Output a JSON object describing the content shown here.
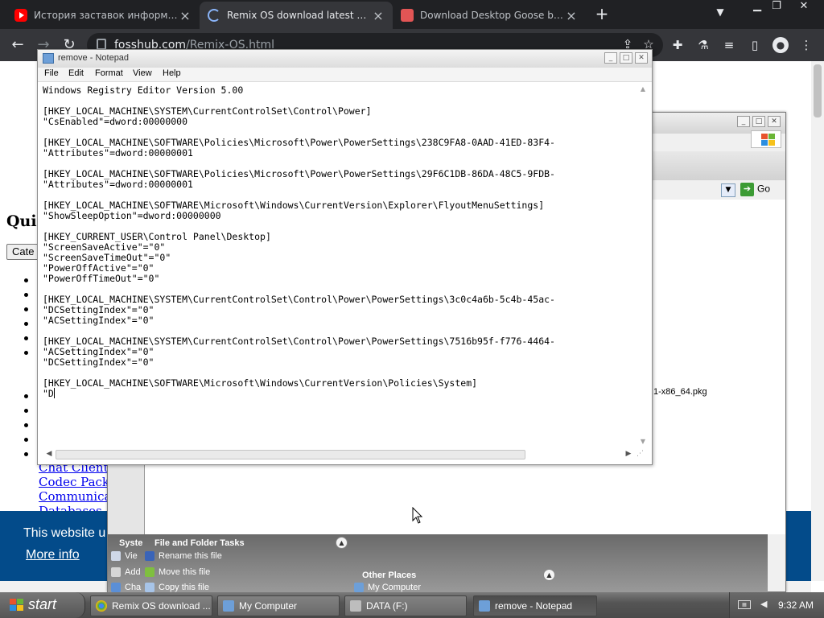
{
  "browser": {
    "tabs": [
      {
        "title": "История заставок информационн",
        "icon": "youtube-icon",
        "active": false
      },
      {
        "title": "Remix OS download latest version",
        "icon": "loading-spinner-icon",
        "active": true
      },
      {
        "title": "Download Desktop Goose by samp",
        "icon": "site-favicon-icon",
        "active": false
      }
    ],
    "url_host": "fosshub.com",
    "url_path": "/Remix-OS.html"
  },
  "webpage": {
    "heading": "Quic",
    "category_button": "Cate",
    "links": [
      "Chat Clients",
      "Codec Packs",
      "Communicat",
      "Databases"
    ],
    "cookie_text": "This website u",
    "cookie_more": "More info"
  },
  "explorer": {
    "go_label": "Go",
    "file_fragment": "1-x86_64.pkg",
    "tasks_header_left": "Syste",
    "tasks_header": "File and Folder Tasks",
    "tasks_left_items": [
      "Vie",
      "Add",
      "Cha"
    ],
    "tasks": [
      "Rename this file",
      "Move this file",
      "Copy this file"
    ],
    "other_places_header": "Other Places",
    "other_places": [
      "My Computer"
    ]
  },
  "notepad": {
    "title": "remove - Notepad",
    "menu": [
      "File",
      "Edit",
      "Format",
      "View",
      "Help"
    ],
    "lines": [
      "Windows Registry Editor Version 5.00",
      "",
      "[HKEY_LOCAL_MACHINE\\SYSTEM\\CurrentControlSet\\Control\\Power]",
      "\"CsEnabled\"=dword:00000000",
      "",
      "[HKEY_LOCAL_MACHINE\\SOFTWARE\\Policies\\Microsoft\\Power\\PowerSettings\\238C9FA8-0AAD-41ED-83F4-",
      "\"Attributes\"=dword:00000001",
      "",
      "[HKEY_LOCAL_MACHINE\\SOFTWARE\\Policies\\Microsoft\\Power\\PowerSettings\\29F6C1DB-86DA-48C5-9FDB-",
      "\"Attributes\"=dword:00000001",
      "",
      "[HKEY_LOCAL_MACHINE\\SOFTWARE\\Microsoft\\Windows\\CurrentVersion\\Explorer\\FlyoutMenuSettings]",
      "\"ShowSleepOption\"=dword:00000000",
      "",
      "[HKEY_CURRENT_USER\\Control Panel\\Desktop]",
      "\"ScreenSaveActive\"=\"0\"",
      "\"ScreenSaveTimeOut\"=\"0\"",
      "\"PowerOffActive\"=\"0\"",
      "\"PowerOffTimeOut\"=\"0\"",
      "",
      "[HKEY_LOCAL_MACHINE\\SYSTEM\\CurrentControlSet\\Control\\Power\\PowerSettings\\3c0c4a6b-5c4b-45ac-",
      "\"DCSettingIndex\"=\"0\"",
      "\"ACSettingIndex\"=\"0\"",
      "",
      "[HKEY_LOCAL_MACHINE\\SYSTEM\\CurrentControlSet\\Control\\Power\\PowerSettings\\7516b95f-f776-4464-",
      "\"ACSettingIndex\"=\"0\"",
      "\"DCSettingIndex\"=\"0\"",
      "",
      "[HKEY_LOCAL_MACHINE\\SOFTWARE\\Microsoft\\Windows\\CurrentVersion\\Policies\\System]",
      "\"D"
    ]
  },
  "taskbar": {
    "start_label": "start",
    "items": [
      {
        "label": "Remix OS download ...",
        "icon": "chrome-icon",
        "active": false
      },
      {
        "label": "My Computer",
        "icon": "my-computer-icon",
        "active": false
      },
      {
        "label": "DATA (F:)",
        "icon": "drive-icon",
        "active": false
      },
      {
        "label": "remove - Notepad",
        "icon": "notepad-icon",
        "active": true
      }
    ],
    "clock": "9:32 AM"
  },
  "colors": {
    "chrome_dark": "#202124",
    "chrome_toolbar": "#35363a",
    "link_blue": "#0000ee",
    "cookie_bar": "#034b8a"
  }
}
